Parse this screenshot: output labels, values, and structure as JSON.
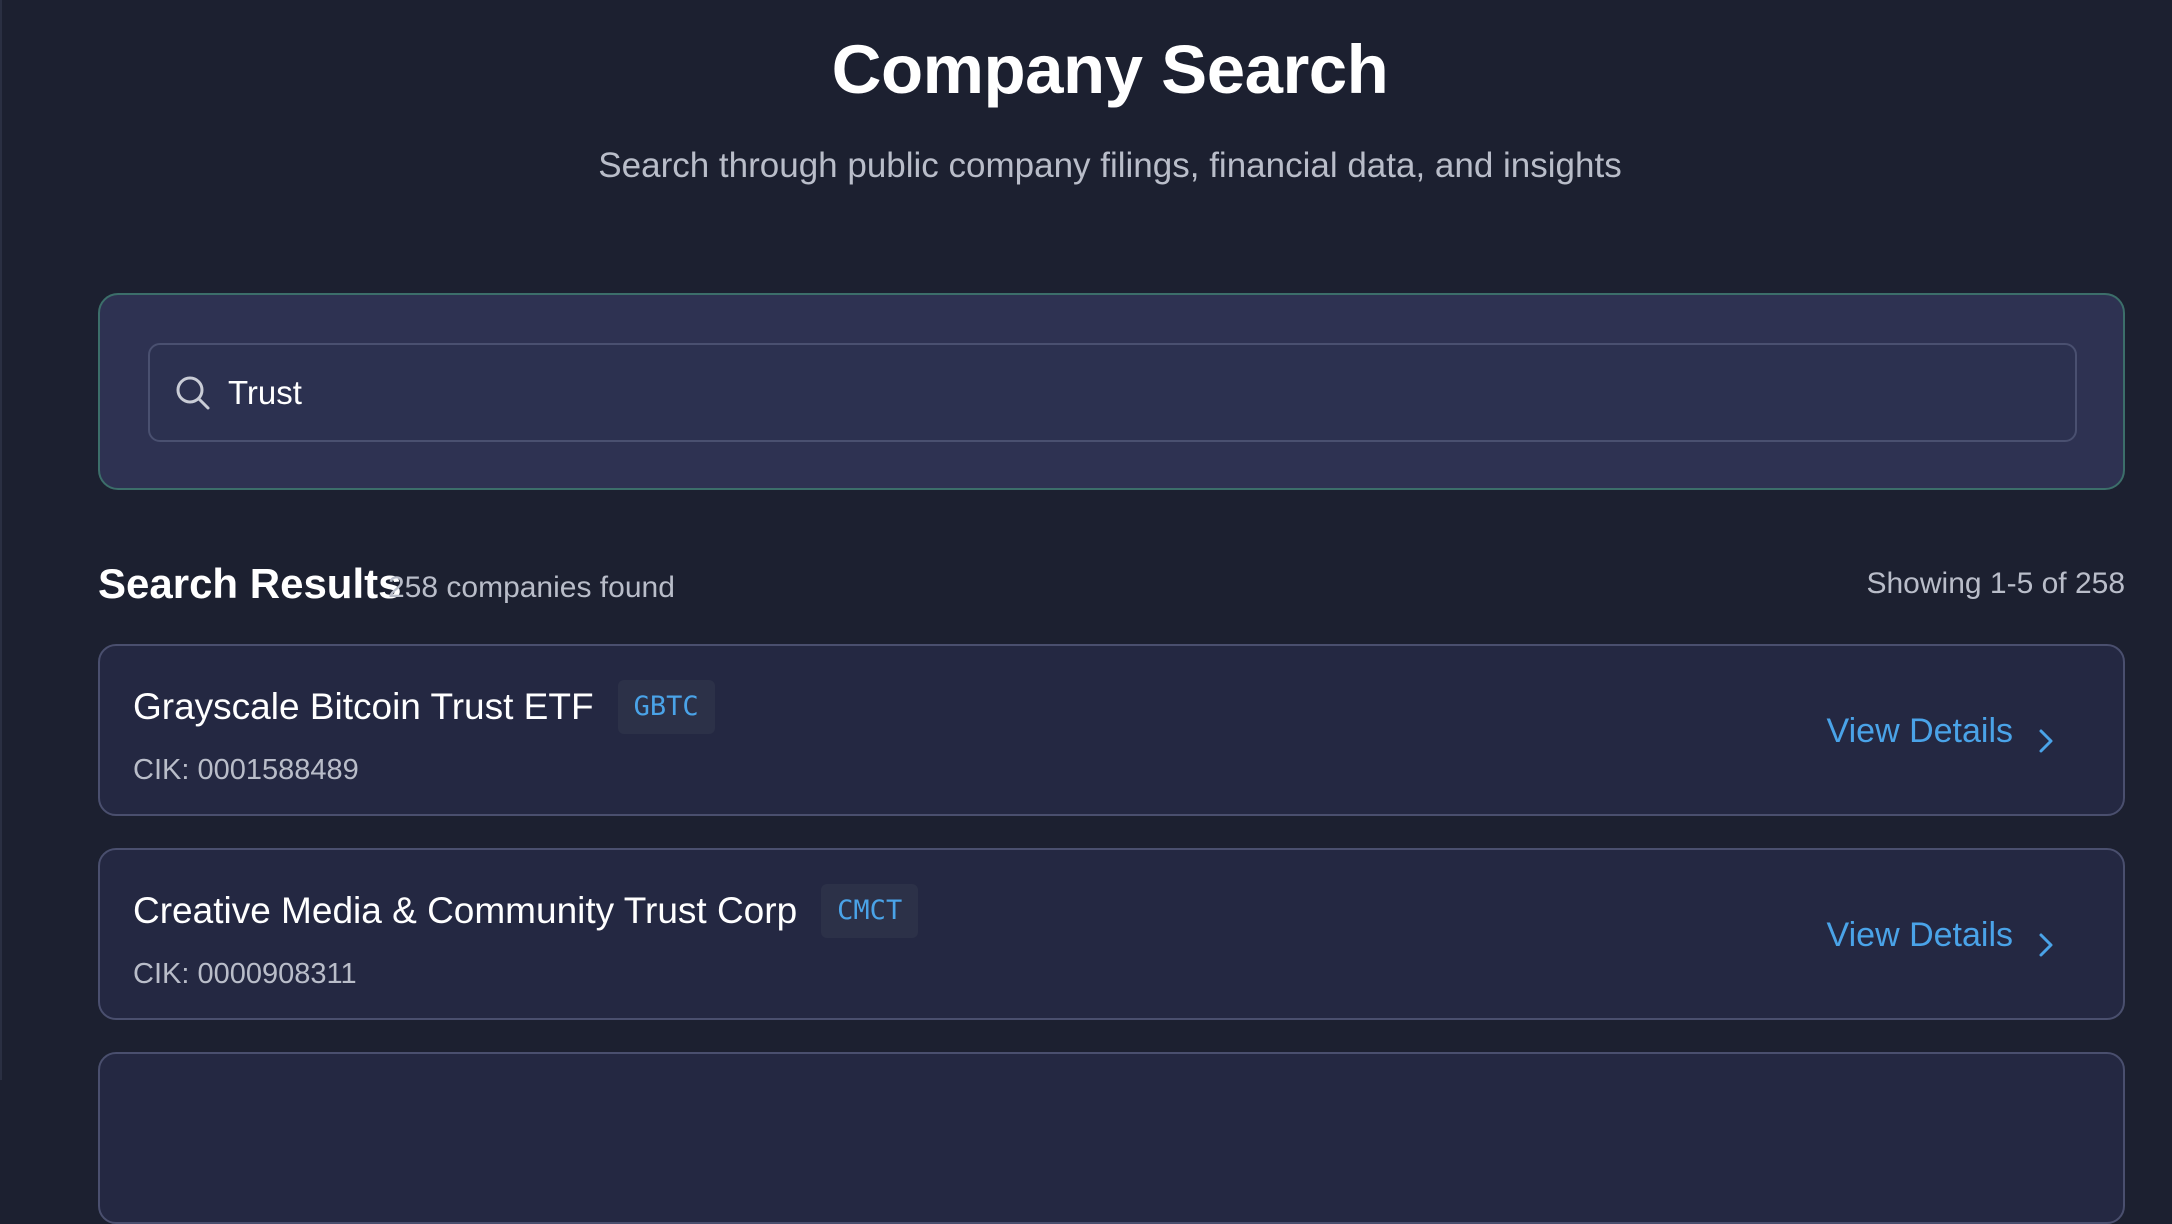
{
  "header": {
    "title": "Company Search",
    "subtitle": "Search through public company filings, financial data, and insights"
  },
  "search": {
    "value": "Trust",
    "icon": "search-icon"
  },
  "results": {
    "title": "Search Results",
    "count_text": "258 companies found",
    "range_text": "Showing 1-5 of 258",
    "items": [
      {
        "name": "Grayscale Bitcoin Trust ETF",
        "ticker": "GBTC",
        "cik": "CIK: 0001588489",
        "action_label": "View Details"
      },
      {
        "name": "Creative Media & Community Trust Corp",
        "ticker": "CMCT",
        "cik": "CIK: 0000908311",
        "action_label": "View Details"
      }
    ]
  },
  "colors": {
    "background": "#1c2030",
    "accent": "#4aa3e8",
    "panel_border": "#3c6e6a"
  }
}
